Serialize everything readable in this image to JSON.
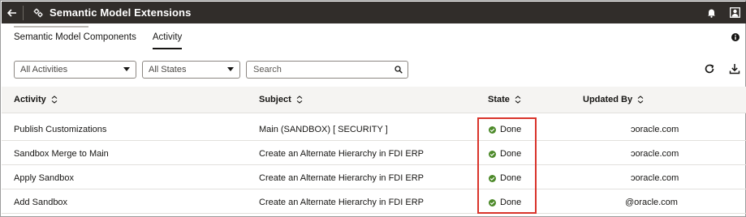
{
  "header": {
    "title": "Semantic Model Extensions",
    "back_icon": "back-arrow-icon",
    "app_icon": "gear-cluster-icon",
    "notification_icon": "bell-icon",
    "user_icon": "user-icon",
    "background_color": "#312d2a"
  },
  "tabs": [
    {
      "label": "Semantic Model Components",
      "active": false
    },
    {
      "label": "Activity",
      "active": true
    }
  ],
  "filters": {
    "activities": {
      "selected": "All Activities"
    },
    "states": {
      "selected": "All States"
    },
    "search": {
      "placeholder": "Search",
      "value": ""
    }
  },
  "toolbar": {
    "refresh_icon": "refresh-icon",
    "download_icon": "download-icon",
    "info_icon": "info-icon"
  },
  "table": {
    "columns": [
      "Activity",
      "Subject",
      "State",
      "Updated By"
    ],
    "rows": [
      {
        "activity": "Publish Customizations",
        "subject": "Main (SANDBOX) [ SECURITY ]",
        "state": "Done",
        "updated_by": "ɔoracle.com"
      },
      {
        "activity": "Sandbox Merge to Main",
        "subject": "Create an Alternate Hierarchy in FDI ERP",
        "state": "Done",
        "updated_by": "ɔoracle.com"
      },
      {
        "activity": "Apply Sandbox",
        "subject": "Create an Alternate Hierarchy in FDI ERP",
        "state": "Done",
        "updated_by": "ɔoracle.com"
      },
      {
        "activity": "Add Sandbox",
        "subject": "Create an Alternate Hierarchy in FDI ERP",
        "state": "Done",
        "updated_by": "@oracle.com"
      }
    ]
  },
  "colors": {
    "done": "#4d8a2a",
    "highlight": "#d9342b"
  }
}
